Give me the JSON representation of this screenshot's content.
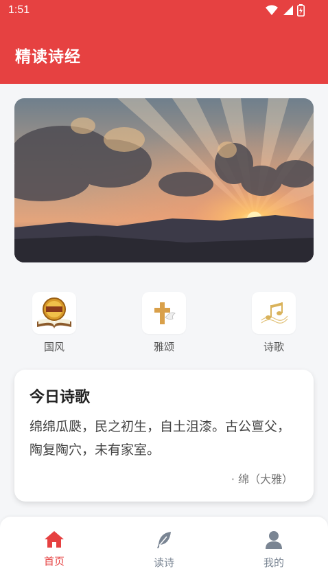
{
  "status": {
    "time": "1:51"
  },
  "header": {
    "title": "精读诗经"
  },
  "categories": [
    {
      "label": "国风",
      "icon": "holy-bible-book-icon"
    },
    {
      "label": "雅颂",
      "icon": "cross-dove-icon"
    },
    {
      "label": "诗歌",
      "icon": "music-notes-icon"
    }
  ],
  "daily": {
    "title": "今日诗歌",
    "text": "绵绵瓜瓞，民之初生，自土沮漆。古公亶父，陶复陶穴，未有家室。",
    "source": "· 绵（大雅）"
  },
  "tabs": [
    {
      "label": "首页",
      "icon": "home-icon",
      "active": true
    },
    {
      "label": "读诗",
      "icon": "feather-icon",
      "active": false
    },
    {
      "label": "我的",
      "icon": "person-icon",
      "active": false
    }
  ],
  "colors": {
    "primary": "#e64141",
    "inactive": "#7a8593"
  }
}
